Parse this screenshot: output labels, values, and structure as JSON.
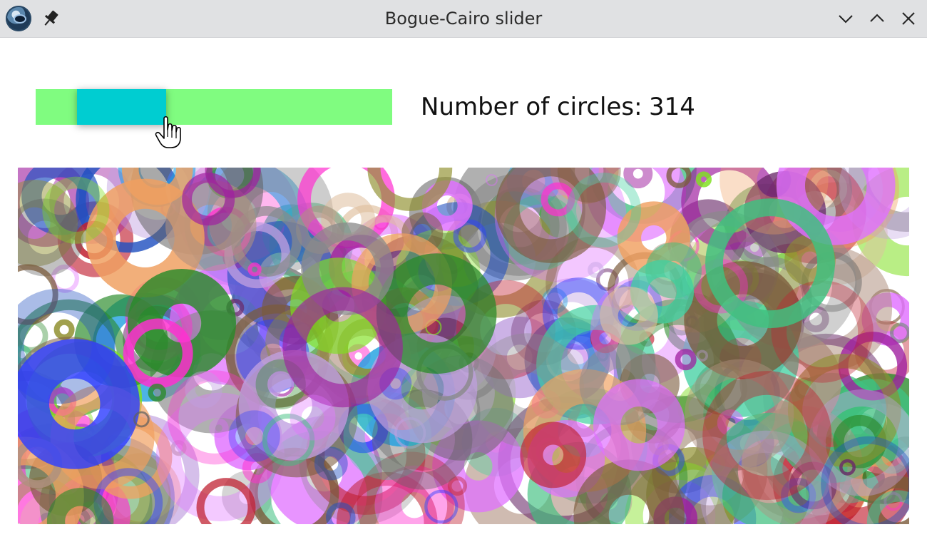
{
  "window": {
    "title": "Bogue-Cairo slider",
    "icons": {
      "app": "bogue-app-icon",
      "pin": "pin-icon",
      "minimize": "chevron-down-icon",
      "maximize": "chevron-up-icon",
      "close": "close-icon"
    }
  },
  "slider": {
    "label": "Number of circles:",
    "value": "314",
    "level_fraction": 0.24,
    "track_color": "#80fc80",
    "thumb_color": "#00cdd1"
  },
  "canvas": {
    "circle_count": 314
  }
}
